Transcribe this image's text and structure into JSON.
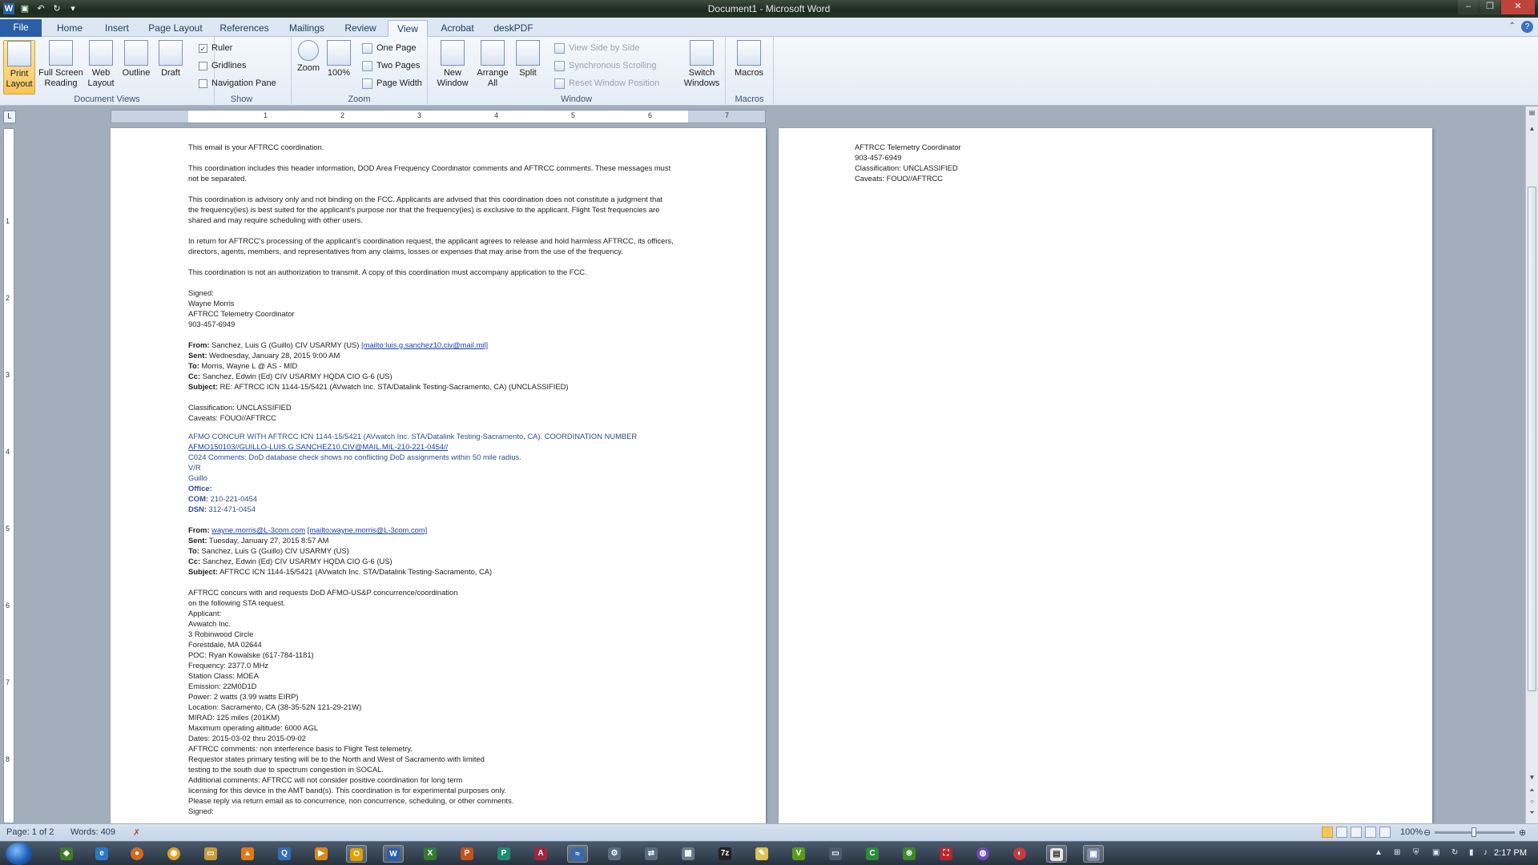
{
  "window": {
    "title": "Document1 - Microsoft Word"
  },
  "tabs": [
    {
      "label": "File"
    },
    {
      "label": "Home"
    },
    {
      "label": "Insert"
    },
    {
      "label": "Page Layout"
    },
    {
      "label": "References"
    },
    {
      "label": "Mailings"
    },
    {
      "label": "Review"
    },
    {
      "label": "View"
    },
    {
      "label": "Acrobat"
    },
    {
      "label": "deskPDF"
    }
  ],
  "ribbon": {
    "document_views": {
      "label": "Document Views",
      "print_layout": "Print Layout",
      "full_screen_reading": "Full Screen Reading",
      "web_layout": "Web Layout",
      "outline": "Outline",
      "draft": "Draft"
    },
    "show": {
      "label": "Show",
      "ruler": "Ruler",
      "gridlines": "Gridlines",
      "navigation_pane": "Navigation Pane"
    },
    "zoom": {
      "label": "Zoom",
      "zoom": "Zoom",
      "hundred": "100%",
      "one_page": "One Page",
      "two_pages": "Two Pages",
      "page_width": "Page Width"
    },
    "window_group": {
      "label": "Window",
      "new_window": "New Window",
      "arrange_all": "Arrange All",
      "split": "Split",
      "view_side_by_side": "View Side by Side",
      "synchronous_scrolling": "Synchronous Scrolling",
      "reset_window_position": "Reset Window Position",
      "switch_windows": "Switch Windows"
    },
    "macros": {
      "label": "Macros",
      "macros": "Macros"
    }
  },
  "ruler_numbers": [
    "1",
    "2",
    "3",
    "4",
    "5",
    "6",
    "7"
  ],
  "vruler_numbers": [
    "1",
    "2",
    "3",
    "4",
    "5",
    "6",
    "7",
    "8"
  ],
  "page1": {
    "intro": "This email is your AFTRCC coordination.",
    "p1": "This coordination includes this header information, DOD Area Frequency Coordinator comments and AFTRCC comments. These messages must",
    "p1b": "not be separated.",
    "p2": "This coordination is advisory only and not binding on the FCC. Applicants are advised that this coordination does not constitute a judgment that",
    "p2b": "the frequency(ies) is best suited for the applicant's purpose nor that the frequency(ies) is exclusive to the applicant. Flight Test frequencies are",
    "p2c": "shared and may require scheduling with other users.",
    "p3": "In return for AFTRCC's processing of the applicant's coordination request, the applicant agrees to release and hold harmless AFTRCC, its officers,",
    "p3b": "directors, agents, members, and representatives from any claims, losses or expenses that may arise from the use of the frequency.",
    "p4": "This coordination is not an authorization to transmit. A copy of this coordination must accompany application to the FCC.",
    "sig1": "Signed:",
    "sig2": "Wayne Morris",
    "sig3": "AFTRCC Telemetry Coordinator",
    "sig4": "903-457-6949",
    "m1_from_label": "From:",
    "m1_from": "Sanchez, Luis G (Guillo) CIV USARMY (US)",
    "m1_from_link": "[mailto:luis.g.sanchez10.civ@mail.mil]",
    "m1_sent_label": "Sent:",
    "m1_sent": "Wednesday, January 28, 2015 9:00 AM",
    "m1_to_label": "To:",
    "m1_to": "Morris, Wayne L @ AS - MID",
    "m1_cc_label": "Cc:",
    "m1_cc": "Sanchez, Edwin (Ed) CIV USARMY HQDA CIO G-6 (US)",
    "m1_subject_label": "Subject:",
    "m1_subject": "RE: AFTRCC ICN 1144-15/5421 (AVwatch Inc. STA/Datalink Testing-Sacramento, CA) (UNCLASSIFIED)",
    "class": "Classification: UNCLASSIFIED",
    "caveats": "Caveats: FOUO//AFTRCC",
    "afmo1": "AFMO CONCUR WITH AFTRCC ICN 1144-15/5421 (AVwatch Inc. STA/Datalink Testing-Sacramento, CA).  COORDINATION NUMBER",
    "afmo2": "AFMO150103//GUILLO-LUIS.G.SANCHEZ10.CIV@MAIL.MIL-210-221-0454//",
    "afmo3": "C024 Comments: DoD database check shows no conflicting DoD assignments within 50 mile radius.",
    "afmo4": "V/R",
    "afmo5": "Guillo",
    "afmo6": "Office:",
    "afmo7_label": "COM:",
    "afmo7": "210-221-0454",
    "afmo8_label": "DSN:",
    "afmo8": "312-471-0454",
    "m2_from_label": "From:",
    "m2_from": "wayne.morris@L-3com.com",
    "m2_from_link": "[mailto:wayne.morris@L-3com.com]",
    "m2_sent_label": "Sent:",
    "m2_sent": "Tuesday, January 27, 2015 8:57 AM",
    "m2_to_label": "To:",
    "m2_to": "Sanchez, Luis G (Guillo) CIV USARMY (US)",
    "m2_cc_label": "Cc:",
    "m2_cc": "Sanchez, Edwin (Ed) CIV USARMY HQDA CIO G-6 (US)",
    "m2_subject_label": "Subject:",
    "m2_subject": "AFTRCC ICN 1144-15/5421 (AVwatch Inc. STA/Datalink Testing-Sacramento, CA)",
    "body": [
      "AFTRCC concurs with and requests DoD AFMO-US&P concurrence/coordination",
      "on the following STA request.",
      "Applicant:",
      "Avwatch Inc.",
      "3 Robinwood Circle",
      "Forestdale, MA 02644",
      "POC:  Ryan Kowalske (617-784-1181)",
      "Frequency:  2377.0 MHz",
      "Station Class:   MOEA",
      "Emission:  22M0D1D",
      "Power:  2 watts (3.99 watts EIRP)",
      "Location:  Sacramento, CA (38-35-52N 121-29-21W)",
      "MIRAD:  125 miles (201KM)",
      "Maximum operating altitude:  6000 AGL",
      "Dates:  2015-03-02 thru 2015-09-02",
      "AFTRCC comments: non interference basis to Flight Test telemetry.",
      "Requestor states primary testing will be to the North and West of Sacramento with limited",
      "testing to the south due to spectrum congestion in SOCAL.",
      "Additional comments:  AFTRCC will not consider positive coordination for long term",
      "licensing for this device in the AMT band(s). This coordination is for experimental purposes only.",
      "Please reply via return email as to concurrence, non concurrence, scheduling, or other comments.",
      "Signed:"
    ]
  },
  "page2": {
    "l1": "AFTRCC Telemetry Coordinator",
    "l2": "903-457-6949",
    "l3": "Classification: UNCLASSIFIED",
    "l4": "Caveats: FOUO//AFTRCC"
  },
  "status": {
    "page": "Page: 1 of 2",
    "words": "Words: 409",
    "zoom": "100%"
  },
  "taskbar": {
    "clock": "2:17 PM"
  },
  "colors": {
    "accent": "#2a5fa8",
    "active_btn": "#f7c55b",
    "email_blue": "#2d4f8f"
  }
}
